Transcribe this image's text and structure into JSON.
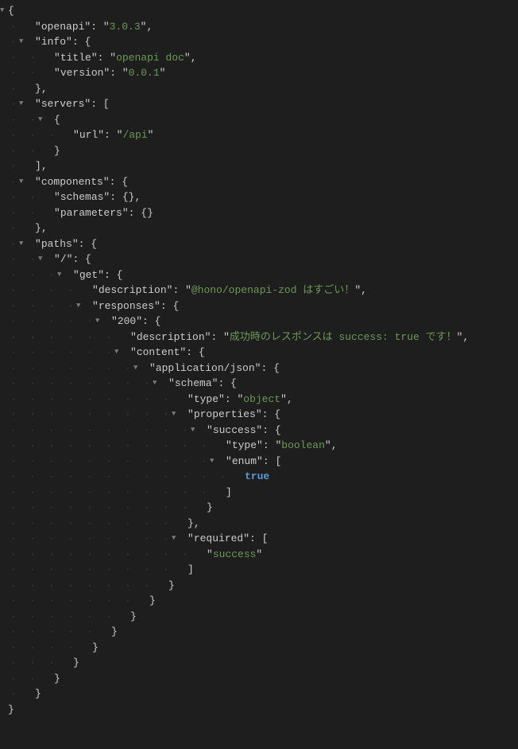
{
  "caret": "▼",
  "tok": {
    "lbrace": "{",
    "rbrace": "}",
    "lbrack": "[",
    "rbrack": "]",
    "comma": ",",
    "colon": ": ",
    "q": "\""
  },
  "keys": {
    "openapi": "openapi",
    "info": "info",
    "title": "title",
    "version": "version",
    "servers": "servers",
    "url": "url",
    "components": "components",
    "schemas": "schemas",
    "parameters": "parameters",
    "paths": "paths",
    "root": "/",
    "get": "get",
    "description": "description",
    "responses": "responses",
    "r200": "200",
    "content": "content",
    "appjson": "application/json",
    "schema": "schema",
    "type": "type",
    "properties": "properties",
    "success": "success",
    "enum": "enum",
    "required": "required"
  },
  "vals": {
    "openapi": "3.0.3",
    "title": "openapi doc",
    "version": "0.0.1",
    "url": "/api",
    "desc1": "@hono/openapi-zod はすごい！",
    "desc2": "成功時のレスポンスは success: true です！",
    "object": "object",
    "boolean": "boolean",
    "true": "true",
    "success": "success"
  }
}
